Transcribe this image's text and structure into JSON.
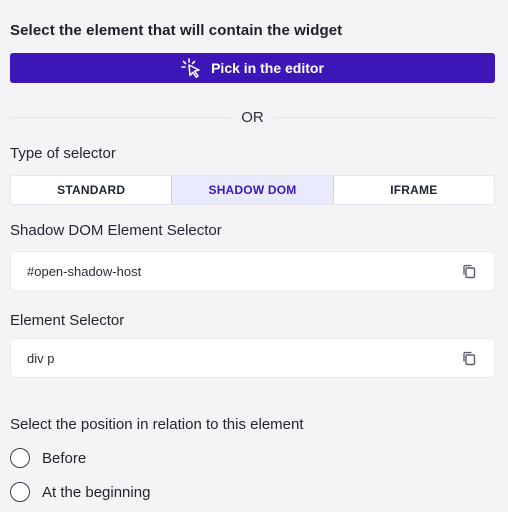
{
  "container": {
    "title": "Select the element that will contain the widget",
    "pick_button_label": "Pick in the editor",
    "or_text": "OR"
  },
  "selector_type": {
    "label": "Type of selector",
    "options": [
      "STANDARD",
      "SHADOW DOM",
      "IFRAME"
    ],
    "selected": "SHADOW DOM"
  },
  "shadow_dom_selector": {
    "label": "Shadow DOM Element Selector",
    "value": "#open-shadow-host",
    "icon": "copy-icon"
  },
  "element_selector": {
    "label": "Element Selector",
    "value": "div p",
    "icon": "copy-icon"
  },
  "position": {
    "label": "Select the position in relation to this element",
    "options": [
      "Before",
      "At the beginning"
    ]
  },
  "colors": {
    "accent": "#3d16b8",
    "selected_bg": "#eaeaff",
    "background": "#f4f4f6"
  }
}
